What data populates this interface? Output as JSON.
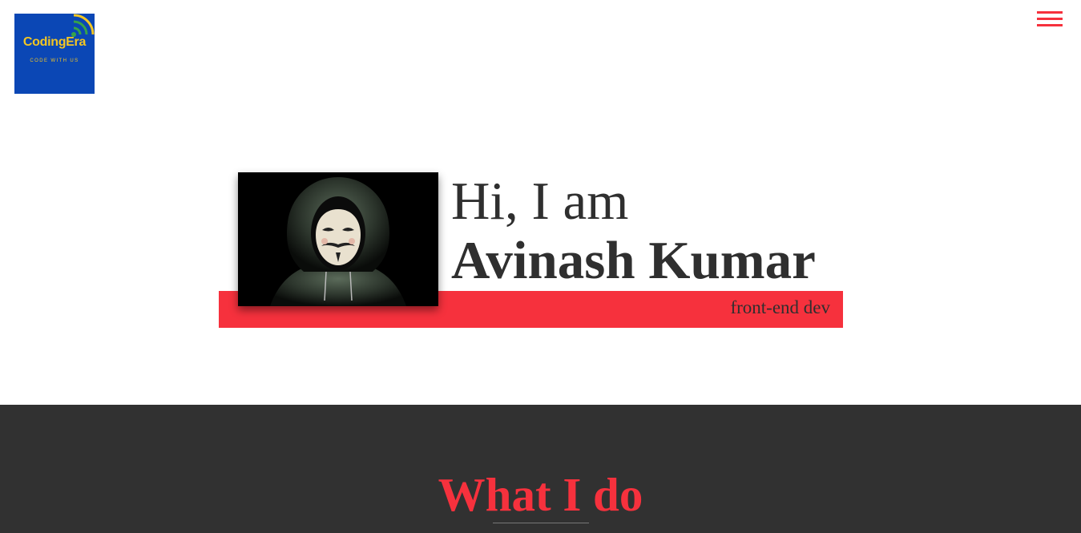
{
  "header": {
    "logo": {
      "title": "CodingEra",
      "tagline": "CODE WITH US",
      "bg_color": "#0b47b5",
      "text_color": "#f3c623"
    },
    "menu_icon": "hamburger-menu-icon"
  },
  "hero": {
    "greeting": "Hi, I am",
    "name": "Avinash Kumar",
    "role": "front-end dev",
    "avatar_icon": "hooded-mask-avatar",
    "accent_color": "#f6313d"
  },
  "section": {
    "title": "What I do",
    "bg_color": "#313131"
  }
}
